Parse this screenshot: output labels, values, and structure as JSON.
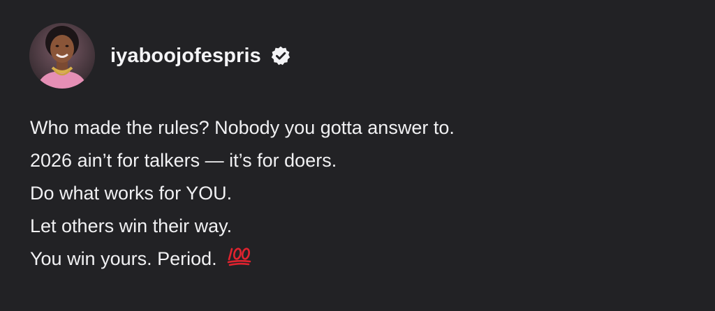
{
  "post": {
    "username": "iyaboojofespris",
    "verified": true,
    "lines": [
      "Who made the rules? Nobody you gotta answer to.",
      "2026 ain’t for talkers — it’s for doers.",
      "Do what works for YOU.",
      "Let others win their way.",
      "You win yours. Period."
    ],
    "trailing_emoji": "hundred-points-icon"
  },
  "colors": {
    "background": "#222225",
    "text": "#f1f1f3",
    "emoji_red": "#e0232f"
  }
}
